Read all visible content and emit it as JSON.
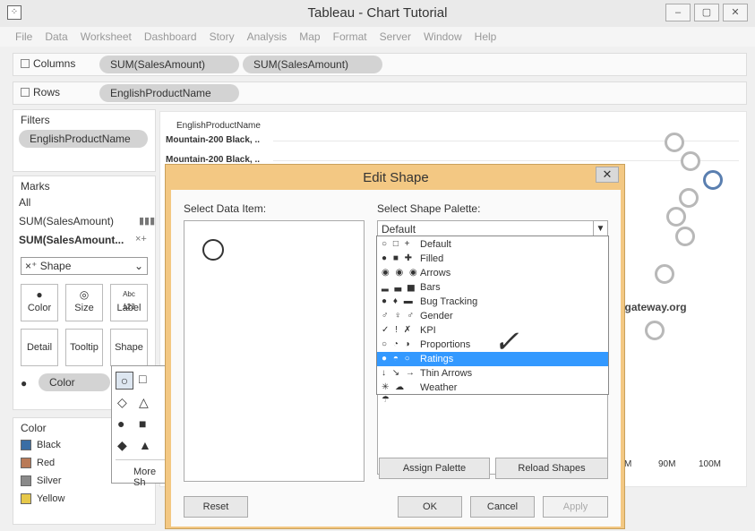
{
  "window": {
    "title": "Tableau - Chart Tutorial",
    "minimize": "–",
    "maximize": "▢",
    "close": "✕"
  },
  "menu": [
    "File",
    "Data",
    "Worksheet",
    "Dashboard",
    "Story",
    "Analysis",
    "Map",
    "Format",
    "Server",
    "Window",
    "Help"
  ],
  "columns_shelf": {
    "label": "Columns",
    "pills": [
      "SUM(SalesAmount)",
      "SUM(SalesAmount)"
    ]
  },
  "rows_shelf": {
    "label": "Rows",
    "pills": [
      "EnglishProductName"
    ]
  },
  "filters": {
    "title": "Filters",
    "pill": "EnglishProductName"
  },
  "marks": {
    "title": "Marks",
    "items": [
      "All",
      "SUM(SalesAmount)",
      "SUM(SalesAmount..."
    ],
    "mark_type": "Shape",
    "buttons": [
      "Color",
      "Size",
      "Label",
      "Detail",
      "Tooltip",
      "Shape"
    ],
    "label_icon": "Abc 123",
    "color_pill": "Color"
  },
  "shape_popup": {
    "more": "More Sh"
  },
  "color_legend": {
    "title": "Color",
    "items": [
      {
        "name": "Black",
        "color": "#3a6ea5"
      },
      {
        "name": "Red",
        "color": "#b97a57"
      },
      {
        "name": "Silver",
        "color": "#8a8a8a"
      },
      {
        "name": "Yellow",
        "color": "#e6c84a"
      }
    ]
  },
  "chart": {
    "header": "EnglishProductName",
    "rows": [
      "Mountain-200 Black, ..",
      "Mountain-200 Black, .."
    ],
    "axis_ticks": [
      "M",
      "90M",
      "100M"
    ]
  },
  "dialog": {
    "title": "Edit Shape",
    "close": "✕",
    "data_item_label": "Select Data Item:",
    "palette_label": "Select Shape Palette:",
    "selected_palette": "Default",
    "palettes": [
      {
        "icons": "○ □ +",
        "name": "Default"
      },
      {
        "icons": "● ■ ✚",
        "name": "Filled"
      },
      {
        "icons": "◉ ◉ ◉",
        "name": "Arrows"
      },
      {
        "icons": "▂ ▃ ▅",
        "name": "Bars"
      },
      {
        "icons": "● ♦ ▬",
        "name": "Bug Tracking"
      },
      {
        "icons": "♂ ♀ ♂",
        "name": "Gender"
      },
      {
        "icons": "✓ ! ✗",
        "name": "KPI"
      },
      {
        "icons": "○ ◔ ◑",
        "name": "Proportions"
      },
      {
        "icons": "● ◓ ○",
        "name": "Ratings"
      },
      {
        "icons": "↓ ↘ →",
        "name": "Thin Arrows"
      },
      {
        "icons": "✳ ☁ ☂",
        "name": "Weather"
      }
    ],
    "selected_index": 8,
    "assign_palette": "Assign Palette",
    "reload_shapes": "Reload Shapes",
    "reset": "Reset",
    "ok": "OK",
    "cancel": "Cancel",
    "apply": "Apply",
    "check": "✓"
  },
  "watermark": "©tutorialgateway.org"
}
